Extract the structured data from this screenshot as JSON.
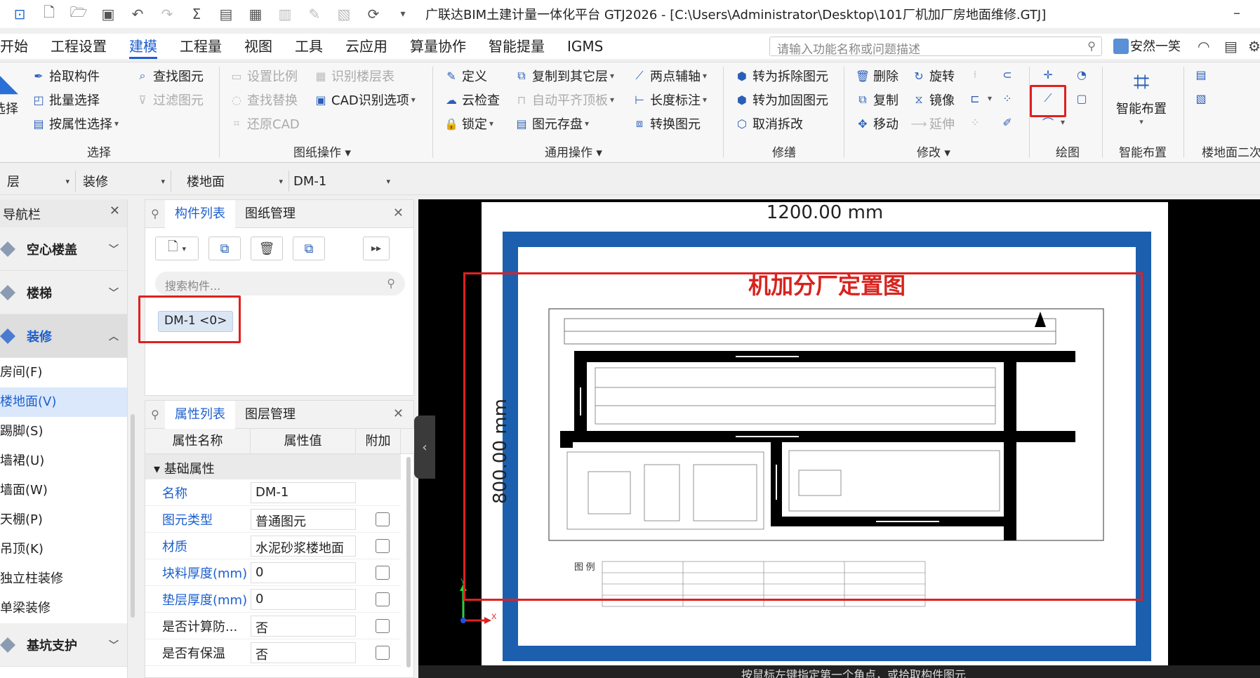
{
  "title": "广联达BIM土建计量一体化平台 GTJ2026 - [C:\\Users\\Administrator\\Desktop\\101厂机加厂房地面维修.GTJ]",
  "menu": [
    "开始",
    "工程设置",
    "建模",
    "工程量",
    "视图",
    "工具",
    "云应用",
    "算量协作",
    "智能提量",
    "IGMS"
  ],
  "menu_active": "建模",
  "search_placeholder": "请输入功能名称或问题描述",
  "user": "安然一笑",
  "ribbon": {
    "select": {
      "pick": "拾取构件",
      "batch": "批量选择",
      "by_attr": "按属性选择",
      "find": "查找图元",
      "filter": "过滤图元",
      "big": "选择",
      "label": "选择"
    },
    "drawing": {
      "scale": "设置比例",
      "identify_floor": "识别楼层表",
      "find_replace": "查找替换",
      "cad_option": "CAD识别选项",
      "restore": "还原CAD",
      "label": "图纸操作"
    },
    "common": {
      "define": "定义",
      "copy_layer": "复制到其它层",
      "two_point": "两点辅轴",
      "cloud_check": "云检查",
      "auto_align": "自动平齐顶板",
      "length_dim": "长度标注",
      "lock": "锁定",
      "save_elem": "图元存盘",
      "convert": "转换图元",
      "label": "通用操作"
    },
    "repair": {
      "to_demolish": "转为拆除图元",
      "to_reinforce": "转为加固图元",
      "cancel_demolish": "取消拆改",
      "label": "修缮"
    },
    "modify": {
      "delete": "删除",
      "rotate": "旋转",
      "copy": "复制",
      "mirror": "镜像",
      "move": "移动",
      "extend": "延伸",
      "label": "修改"
    },
    "draw": {
      "label": "绘图"
    },
    "smart": {
      "big": "智能布置",
      "label": "智能布置"
    },
    "floor2": {
      "label": "楼地面二次"
    }
  },
  "filters": [
    "",
    "装修",
    "楼地面",
    "DM-1"
  ],
  "nav": {
    "title": "导航栏",
    "categories": [
      "空心楼盖",
      "楼梯",
      "装修",
      "基坑支护"
    ],
    "subs": [
      "房间(F)",
      "楼地面(V)",
      "踢脚(S)",
      "墙裙(U)",
      "墙面(W)",
      "天棚(P)",
      "吊顶(K)",
      "独立柱装修",
      "单梁装修"
    ],
    "selected": "楼地面(V)"
  },
  "comp_panel": {
    "tabs": [
      "构件列表",
      "图纸管理"
    ],
    "search_placeholder": "搜索构件...",
    "item": "DM-1 <0>"
  },
  "prop_panel": {
    "tabs": [
      "属性列表",
      "图层管理"
    ],
    "columns": [
      "属性名称",
      "属性值",
      "附加"
    ],
    "group": "基础属性",
    "rows": [
      {
        "name": "名称",
        "value": "DM-1",
        "checkbox": false
      },
      {
        "name": "图元类型",
        "value": "普通图元",
        "checkbox": true
      },
      {
        "name": "材质",
        "value": "水泥砂浆楼地面",
        "checkbox": true
      },
      {
        "name": "块料厚度(mm)",
        "value": "0",
        "checkbox": true
      },
      {
        "name": "垫层厚度(mm)",
        "value": "0",
        "checkbox": true
      },
      {
        "name": "是否计算防...",
        "value": "否",
        "checkbox": true
      },
      {
        "name": "是否有保温",
        "value": "否",
        "checkbox": true
      }
    ]
  },
  "canvas": {
    "dim_top": "1200.00 mm",
    "dim_left": "800.00 mm",
    "plan_title": "机加分厂定置图",
    "legend": "图 例",
    "status": "按鼠标左键指定第一个角点，或拾取构件图元"
  },
  "colors": {
    "accent": "#1c5fcf",
    "frame": "#1b5fae",
    "highlight": "#e02020",
    "title_red": "#d8231e"
  }
}
